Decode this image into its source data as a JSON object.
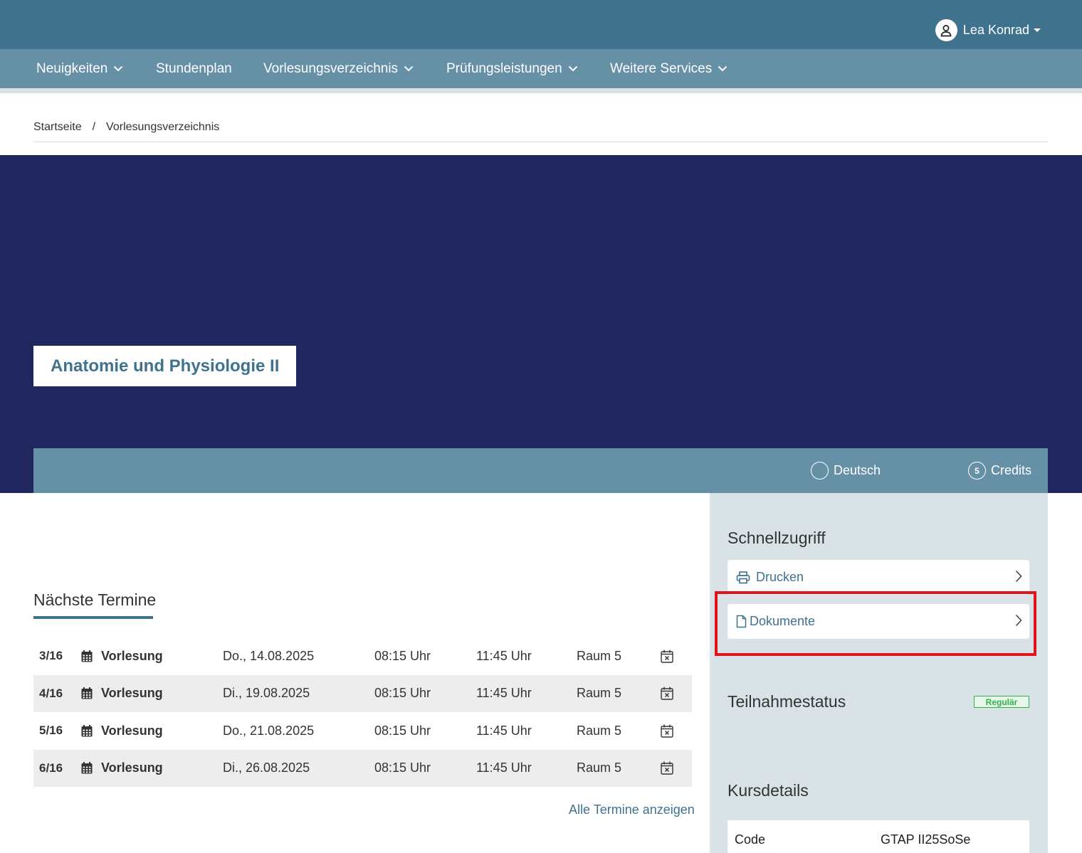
{
  "user": {
    "name": "Lea Konrad"
  },
  "nav": {
    "items": [
      {
        "label": "Neuigkeiten"
      },
      {
        "label": "Stundenplan"
      },
      {
        "label": "Vorlesungsverzeichnis"
      },
      {
        "label": "Prüfungsleistungen"
      },
      {
        "label": "Weitere Services"
      }
    ]
  },
  "breadcrumb": {
    "home": "Startseite",
    "separator": "/",
    "current": "Vorlesungsverzeichnis"
  },
  "course": {
    "title": "Anatomie und Physiologie II",
    "language": "Deutsch",
    "credits_value": "5",
    "credits_label": "Credits"
  },
  "dates": {
    "title": "Nächste Termine",
    "rows": [
      {
        "num": "3/16",
        "type": "Vorlesung",
        "date": "Do., 14.08.2025",
        "start": "08:15 Uhr",
        "end": "11:45 Uhr",
        "room": "Raum 5"
      },
      {
        "num": "4/16",
        "type": "Vorlesung",
        "date": "Di., 19.08.2025",
        "start": "08:15 Uhr",
        "end": "11:45 Uhr",
        "room": "Raum 5"
      },
      {
        "num": "5/16",
        "type": "Vorlesung",
        "date": "Do., 21.08.2025",
        "start": "08:15 Uhr",
        "end": "11:45 Uhr",
        "room": "Raum 5"
      },
      {
        "num": "6/16",
        "type": "Vorlesung",
        "date": "Di., 26.08.2025",
        "start": "08:15 Uhr",
        "end": "11:45 Uhr",
        "room": "Raum 5"
      }
    ],
    "all_link": "Alle Termine anzeigen"
  },
  "sidebar": {
    "quick_title": "Schnellzugriff",
    "print_label": "Drucken",
    "documents_label": "Dokumente",
    "status_title": "Teilnahmestatus",
    "status_badge": "Regulär",
    "details_title": "Kursdetails",
    "details": [
      {
        "key": "Code",
        "value": "GTAP II25SoSe"
      }
    ]
  },
  "colors": {
    "header": "#3e728d",
    "nav": "#6690a6",
    "hero": "#1f275e",
    "sidebar": "#d8e2e7",
    "highlight": "#e0141b",
    "badge": "#2fb24a"
  },
  "icons": [
    "user-icon",
    "chevron-down-icon",
    "globe-icon",
    "credits-icon",
    "calendar-icon",
    "calendar-remove-icon",
    "printer-icon",
    "document-icon",
    "chevron-right-icon"
  ]
}
